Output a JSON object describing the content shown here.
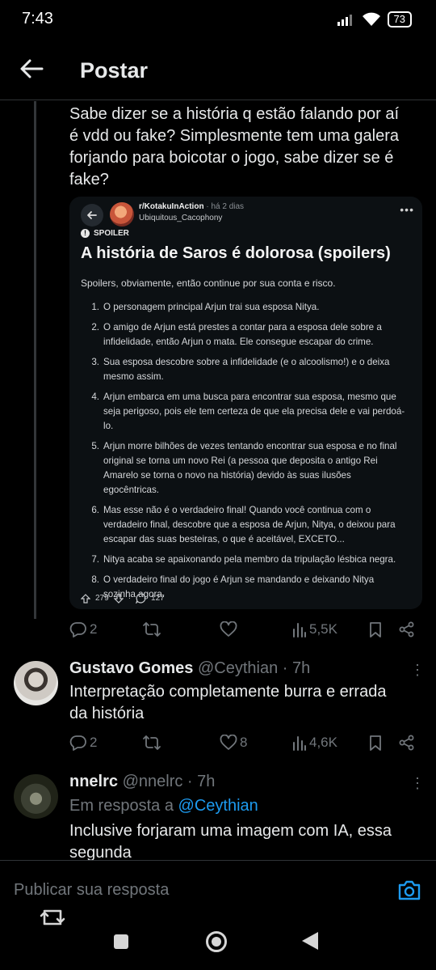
{
  "status": {
    "time": "7:43",
    "battery": "73"
  },
  "header": {
    "title": "Postar"
  },
  "main_tweet": {
    "lines": [
      "Sabe dizer se a história q estão falando por aí",
      "é vdd ou fake? Simplesmente tem uma galera",
      "forjando para boicotar o jogo, sabe dizer se é",
      "fake?"
    ],
    "embed": {
      "subreddit": "r/KotakuInAction",
      "time": "· há 2 dias",
      "user": "Ubiquitous_Cacophony",
      "spoiler_label": "SPOILER",
      "title": "A história de Saros é dolorosa (spoilers)",
      "intro": "Spoilers, obviamente, então continue por sua conta e risco.",
      "items": [
        {
          "n": "1.",
          "lines": [
            "O personagem principal Arjun trai sua esposa Nitya."
          ]
        },
        {
          "n": "2.",
          "lines": [
            "O amigo de Arjun está prestes a contar para a esposa dele sobre a",
            "infidelidade, então Arjun o mata. Ele consegue escapar do crime."
          ]
        },
        {
          "n": "3.",
          "lines": [
            "Sua esposa descobre sobre a infidelidade (e o alcoolismo!) e o deixa",
            "mesmo assim."
          ]
        },
        {
          "n": "4.",
          "lines": [
            "Arjun embarca em uma busca para encontrar sua esposa, mesmo que",
            "seja perigoso, pois ele tem certeza de que ela precisa dele e vai perdoá-",
            "lo."
          ]
        },
        {
          "n": "5.",
          "lines": [
            "Arjun morre bilhões de vezes tentando encontrar sua esposa e no final",
            "original se torna um novo Rei (a pessoa que deposita o antigo Rei",
            "Amarelo se torna o novo na história) devido às suas ilusões",
            "egocêntricas."
          ]
        },
        {
          "n": "6.",
          "lines": [
            "Mas esse não é o verdadeiro final! Quando você continua com o",
            "verdadeiro final, descobre que a esposa de Arjun, Nitya, o deixou para",
            "escapar das suas besteiras, o que é aceitável, EXCETO..."
          ]
        },
        {
          "n": "7.",
          "lines": [
            "Nitya acaba se apaixonando pela membro da tripulação lésbica negra."
          ]
        },
        {
          "n": "8.",
          "lines": [
            "O verdadeiro final do jogo é Arjun se mandando e deixando Nitya",
            "sozinha agora."
          ]
        }
      ],
      "upvotes": "279",
      "comments": "127"
    },
    "actions": {
      "replies": "2",
      "retweets": "",
      "likes": "",
      "views": "5,5K"
    }
  },
  "replies": [
    {
      "name": "Gustavo Gomes",
      "handle": "@Ceythian · 7h",
      "lines": [
        "Interpretação completamente burra e errada",
        "da história"
      ],
      "actions": {
        "replies": "2",
        "retweets": "",
        "likes": "8",
        "views": "4,6K"
      }
    },
    {
      "name": "nnelrc",
      "handle": "@nnelrc · 7h",
      "reply_to_prefix": "Em resposta a",
      "reply_to_handle": "@Ceythian",
      "lines": [
        "Inclusive forjaram uma imagem com IA, essa",
        "segunda"
      ]
    }
  ],
  "composer": {
    "placeholder": "Publicar sua resposta"
  },
  "colors": {
    "accent": "#1d9bf0",
    "muted": "#71767b",
    "text": "#e7e9ea"
  }
}
